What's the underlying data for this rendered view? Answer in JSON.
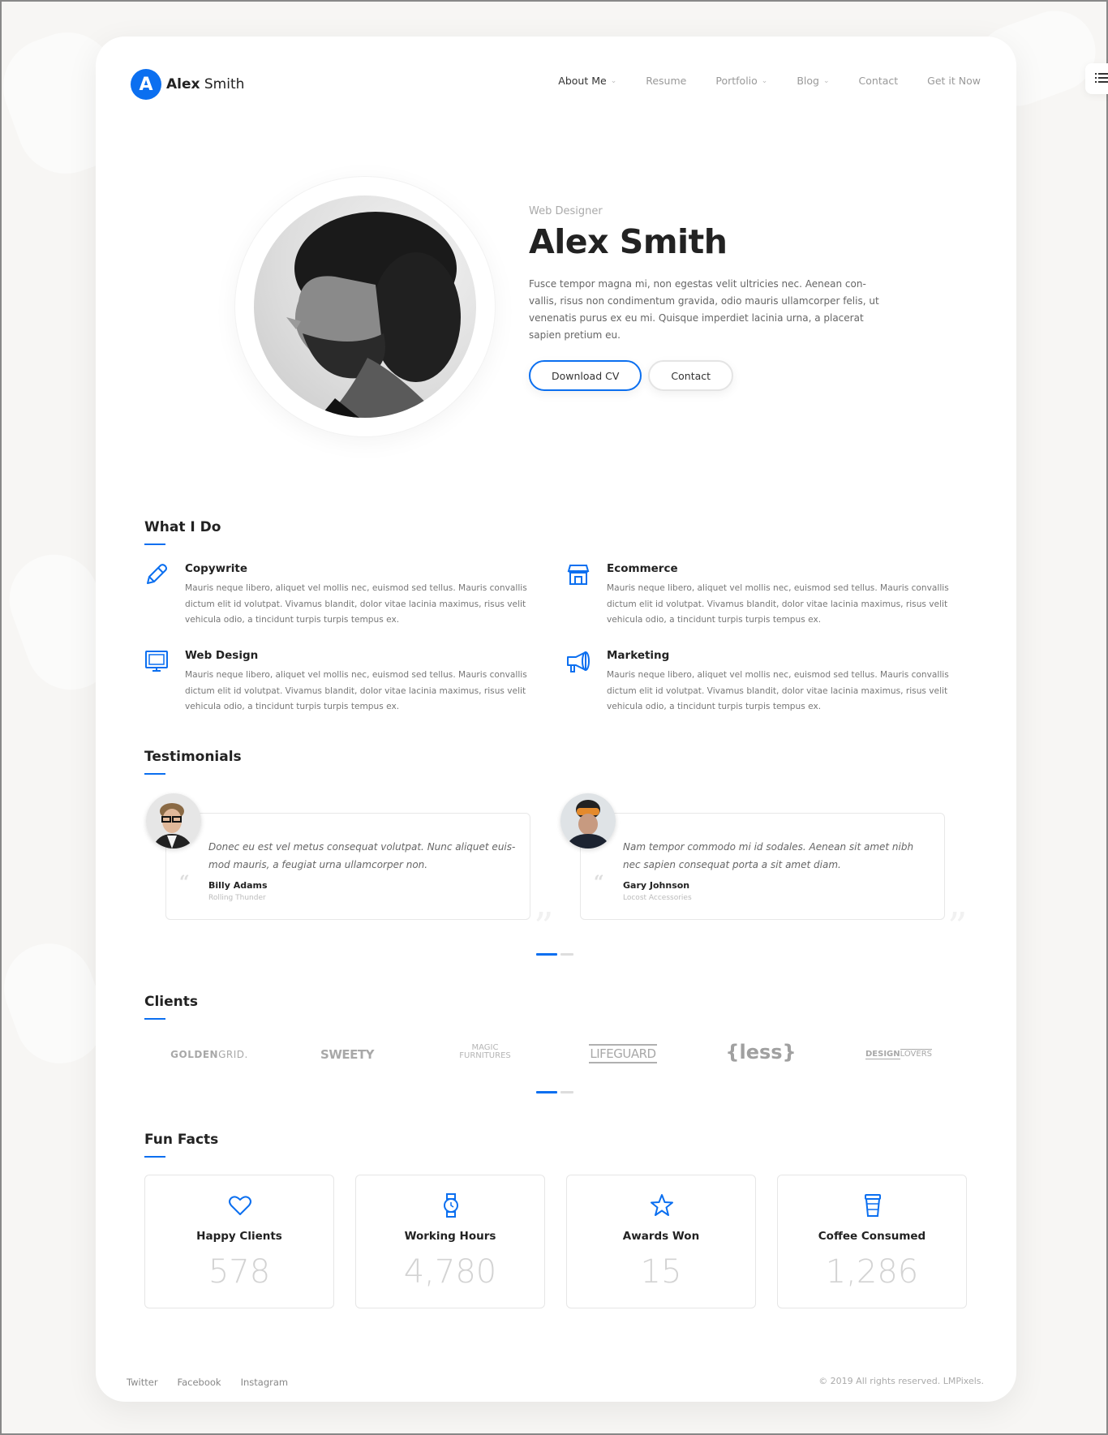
{
  "header": {
    "logo_letter": "A",
    "logo_first": "Alex",
    "logo_last": "Smith",
    "nav": [
      {
        "label": "About Me",
        "dropdown": true,
        "active": true
      },
      {
        "label": "Resume",
        "dropdown": false
      },
      {
        "label": "Portfolio",
        "dropdown": true
      },
      {
        "label": "Blog",
        "dropdown": true
      },
      {
        "label": "Contact",
        "dropdown": false
      },
      {
        "label": "Get it Now",
        "dropdown": false
      }
    ],
    "chevron": "⌄"
  },
  "hero": {
    "subtitle": "Web Designer",
    "name": "Alex Smith",
    "description": "Fusce tempor magna mi, non egestas velit ultricies nec. Aenean con-vallis, risus non condimentum gravida, odio mauris ullamcorper felis, ut venenatis purus ex eu mi. Quisque imperdiet lacinia urna, a placerat sapien pretium eu.",
    "download_label": "Download CV",
    "contact_label": "Contact"
  },
  "what_i_do": {
    "title": "What I Do",
    "services": [
      {
        "icon": "pencil-icon",
        "title": "Copywrite",
        "text": "Mauris neque libero, aliquet vel mollis nec, euismod sed tellus. Mauris convallis dictum elit id volutpat. Vivamus blandit, dolor vitae lacinia maximus, risus velit vehicula odio, a tincidunt turpis turpis tempus ex."
      },
      {
        "icon": "store-icon",
        "title": "Ecommerce",
        "text": "Mauris neque libero, aliquet vel mollis nec, euismod sed tellus. Mauris convallis dictum elit id volutpat. Vivamus blandit, dolor vitae lacinia maximus, risus velit vehicula odio, a tincidunt turpis turpis tempus ex."
      },
      {
        "icon": "monitor-icon",
        "title": "Web Design",
        "text": "Mauris neque libero, aliquet vel mollis nec, euismod sed tellus. Mauris convallis dictum elit id volutpat. Vivamus blandit, dolor vitae lacinia maximus, risus velit vehicula odio, a tincidunt turpis turpis tempus ex."
      },
      {
        "icon": "megaphone-icon",
        "title": "Marketing",
        "text": "Mauris neque libero, aliquet vel mollis nec, euismod sed tellus. Mauris convallis dictum elit id volutpat. Vivamus blandit, dolor vitae lacinia maximus, risus velit vehicula odio, a tincidunt turpis turpis tempus ex."
      }
    ]
  },
  "testimonials": {
    "title": "Testimonials",
    "items": [
      {
        "quote": "Donec eu est vel metus consequat volutpat. Nunc aliquet euis-mod mauris, a feugiat urna ullamcorper non.",
        "name": "Billy Adams",
        "company": "Rolling Thunder"
      },
      {
        "quote": "Nam tempor commodo mi id sodales. Aenean sit amet nibh nec sapien consequat porta a sit amet diam.",
        "name": "Gary Johnson",
        "company": "Locost Accessories"
      }
    ],
    "quote_open": "“",
    "quote_close": "”"
  },
  "clients": {
    "title": "Clients",
    "logos": [
      {
        "a": "GOLDEN",
        "b": "GRID."
      },
      {
        "a": "SWEETY",
        "b": ""
      },
      {
        "a": "MAGIC",
        "b": "FURNITURES"
      },
      {
        "a": "LIFEGUARD",
        "b": ""
      },
      {
        "a": "{less}",
        "b": ""
      },
      {
        "a": "DESIGN",
        "b": "LOVERS"
      }
    ]
  },
  "fun_facts": {
    "title": "Fun Facts",
    "items": [
      {
        "icon": "heart-icon",
        "label": "Happy Clients",
        "value": "578"
      },
      {
        "icon": "watch-icon",
        "label": "Working Hours",
        "value": "4,780"
      },
      {
        "icon": "star-icon",
        "label": "Awards Won",
        "value": "15"
      },
      {
        "icon": "coffee-cup-icon",
        "label": "Coffee Consumed",
        "value": "1,286"
      }
    ]
  },
  "footer": {
    "links": [
      "Twitter",
      "Facebook",
      "Instagram"
    ],
    "copyright": "© 2019 All rights reserved. LMPixels."
  },
  "colors": {
    "accent": "#0b6ff0"
  }
}
